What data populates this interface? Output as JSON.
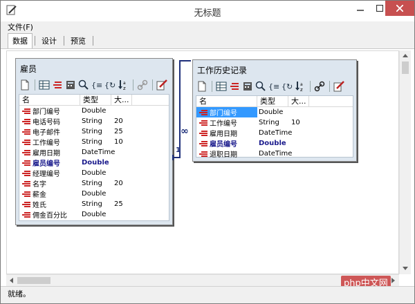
{
  "window": {
    "title": "无标题"
  },
  "menu": {
    "file": "文件(F)"
  },
  "tabs": [
    {
      "label": "数据"
    },
    {
      "label": "设计"
    },
    {
      "label": "预览"
    }
  ],
  "columns": {
    "name": "名",
    "type": "类型",
    "size": "大..."
  },
  "employee_table": {
    "title": "雇员",
    "fields": [
      {
        "name": "部门编号",
        "type": "Double",
        "size": ""
      },
      {
        "name": "电话号码",
        "type": "String",
        "size": "20"
      },
      {
        "name": "电子邮件",
        "type": "String",
        "size": "25"
      },
      {
        "name": "工作编号",
        "type": "String",
        "size": "10"
      },
      {
        "name": "雇用日期",
        "type": "DateTime",
        "size": ""
      },
      {
        "name": "雇员编号",
        "type": "Double",
        "size": ""
      },
      {
        "name": "经理编号",
        "type": "Double",
        "size": ""
      },
      {
        "name": "名字",
        "type": "String",
        "size": "20"
      },
      {
        "name": "薪金",
        "type": "Double",
        "size": ""
      },
      {
        "name": "姓氏",
        "type": "String",
        "size": "25"
      },
      {
        "name": "佣金百分比",
        "type": "Double",
        "size": ""
      }
    ]
  },
  "history_table": {
    "title": "工作历史记录",
    "fields": [
      {
        "name": "部门编号",
        "type": "Double",
        "size": ""
      },
      {
        "name": "工作编号",
        "type": "String",
        "size": "10"
      },
      {
        "name": "雇用日期",
        "type": "DateTime",
        "size": ""
      },
      {
        "name": "雇员编号",
        "type": "Double",
        "size": ""
      },
      {
        "name": "退职日期",
        "type": "DateTime",
        "size": ""
      }
    ]
  },
  "relation": {
    "many": "∞",
    "one": "1"
  },
  "status": {
    "text": "就绪。"
  },
  "watermark": {
    "text": "php中文网"
  },
  "colors": {
    "accent": "#1e2f7a",
    "selection": "#3399ff",
    "panel": "#dde6ef"
  }
}
